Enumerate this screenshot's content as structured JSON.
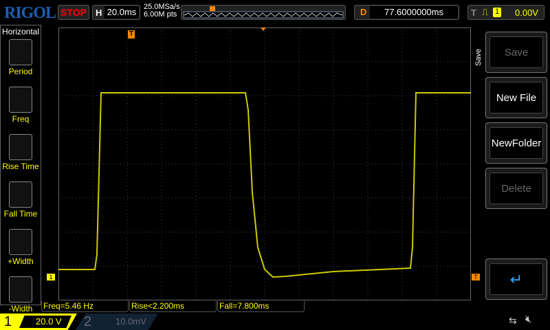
{
  "brand": "RIGOL",
  "status": "STOP",
  "horizontal": {
    "label": "H",
    "timebase": "20.0ms",
    "sample_rate": "25.0MSa/s",
    "memory_depth": "6.00M pts"
  },
  "delay": {
    "label": "D",
    "value": "77.6000000ms"
  },
  "trigger": {
    "label": "T",
    "source": "1",
    "level": "0.00V",
    "slope": "rising"
  },
  "left_menu": {
    "title": "Horizontal",
    "items": [
      {
        "label": "Period"
      },
      {
        "label": "Freq"
      },
      {
        "label": "Rise Time"
      },
      {
        "label": "Fall Time"
      },
      {
        "label": "+Width"
      },
      {
        "label": "-Width"
      }
    ]
  },
  "right_menu": {
    "title": "Save",
    "buttons": [
      {
        "label": "Save",
        "enabled": false
      },
      {
        "label": "New File",
        "enabled": true
      },
      {
        "label": "NewFolder",
        "enabled": true
      },
      {
        "label": "Delete",
        "enabled": false
      }
    ]
  },
  "measurements": [
    "Freq=5.46 Hz",
    "Rise<2.200ms",
    "Fall=7.800ms"
  ],
  "channels": [
    {
      "num": "1",
      "scale": "20.0 V",
      "color": "#ffff00"
    },
    {
      "num": "2",
      "scale": "10.0mV",
      "color": "#00a0a0"
    }
  ],
  "markers": {
    "ch1": "1",
    "trig": "T"
  }
}
